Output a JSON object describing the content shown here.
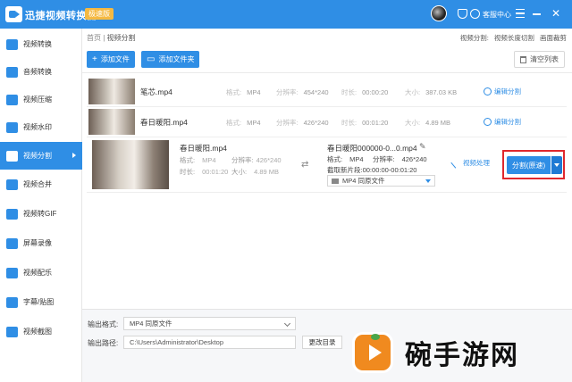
{
  "app": {
    "title": "迅捷视频转换器",
    "edition_badge": "极速版",
    "service_label": "客服中心",
    "colors": {
      "accent": "#2f8ee5",
      "highlight_border": "#e0282d",
      "badge": "#f5b942"
    }
  },
  "sidebar": {
    "items": [
      {
        "label": "视频转换",
        "icon": "video-convert-icon"
      },
      {
        "label": "音频转换",
        "icon": "audio-convert-icon"
      },
      {
        "label": "视频压缩",
        "icon": "compress-icon"
      },
      {
        "label": "视频水印",
        "icon": "watermark-icon"
      },
      {
        "label": "视频分割",
        "icon": "split-icon",
        "active": true
      },
      {
        "label": "视频合并",
        "icon": "merge-icon"
      },
      {
        "label": "视频转GIF",
        "icon": "gif-icon"
      },
      {
        "label": "屏幕录像",
        "icon": "screen-record-icon"
      },
      {
        "label": "视频配乐",
        "icon": "music-icon"
      },
      {
        "label": "字幕/贴图",
        "icon": "subtitle-icon"
      },
      {
        "label": "视频截图",
        "icon": "screenshot-icon"
      }
    ]
  },
  "breadcrumb": {
    "home": "首页",
    "sep": "|",
    "current": "视频分割"
  },
  "header_right": {
    "prefix": "视频分割:",
    "option1": "视频长度切割",
    "option2": "画面裁剪"
  },
  "toolbar": {
    "add_file": "添加文件",
    "add_folder": "添加文件夹",
    "clear_list": "清空列表"
  },
  "files": [
    {
      "name": "笔芯.mp4",
      "format_label": "格式:",
      "format": "MP4",
      "res_label": "分辨率:",
      "resolution": "454*240",
      "dur_label": "时长:",
      "duration": "00:00:20",
      "size_label": "大小:",
      "size": "387.03 KB",
      "action": "编辑分割"
    },
    {
      "name": "春日暖阳.mp4",
      "format_label": "格式:",
      "format": "MP4",
      "res_label": "分辨率:",
      "resolution": "426*240",
      "dur_label": "时长:",
      "duration": "00:01:20",
      "size_label": "大小:",
      "size": "4.89 MB",
      "action": "编辑分割"
    }
  ],
  "expanded": {
    "name": "春日暖阳.mp4",
    "format_label": "格式:",
    "format": "MP4",
    "res_label": "分辨率:",
    "resolution": "426*240",
    "dur_label": "时长:",
    "duration": "00:01:20",
    "size_label": "大小:",
    "size": "4.89 MB",
    "out_name": "春日暖阳000000-0...0.mp4",
    "out_format_label": "格式:",
    "out_format": "MP4",
    "out_res_label": "分辨率:",
    "out_resolution": "426*240",
    "clip_label": "截取新片段:",
    "clip_range": "00:00:00-00:01:20",
    "out_select": "MP4  同原文件",
    "video_process": "视频处理",
    "split_button": "分割(原速)"
  },
  "bottom": {
    "format_label": "输出格式:",
    "format_value": "MP4  同原文件",
    "path_label": "输出路径:",
    "path_value": "C:\\Users\\Administrator\\Desktop",
    "change_dir": "更改目录"
  },
  "watermark": {
    "text": "碗手游网"
  }
}
